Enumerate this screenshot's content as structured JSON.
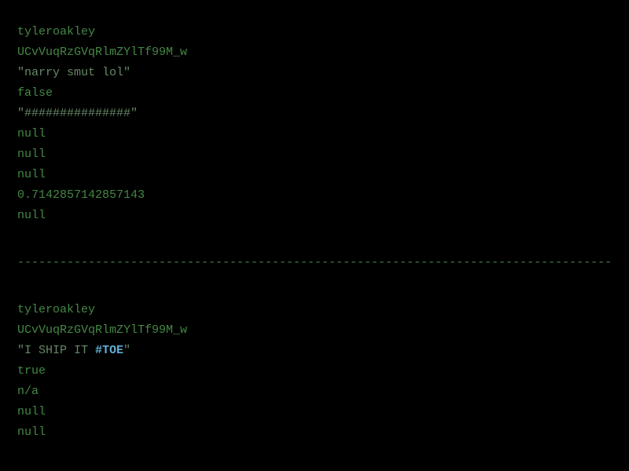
{
  "records": [
    {
      "username": "tyleroakley",
      "channel_id": "UCvVuqRzGVqRlmZYlTf99M_w",
      "title_prefix": "\"narry smut lol\"",
      "hashtag_in_title": null,
      "title_suffix": null,
      "flag": "false",
      "field5": "\"###############\"",
      "field6": "null",
      "field7": "null",
      "field8": "null",
      "field9": "0.7142857142857143",
      "field10": "null"
    },
    {
      "username": "tyleroakley",
      "channel_id": "UCvVuqRzGVqRlmZYlTf99M_w",
      "title_prefix": "\"I SHIP IT ",
      "hashtag_in_title": "#TOE",
      "title_suffix": "\"",
      "flag": "true",
      "field5": "n/a",
      "field6": "null",
      "field7": "null",
      "field8": null,
      "field9": null,
      "field10": null
    }
  ],
  "separator": "----------------------------------------------------------------------------------------------------------------------------------------------------------"
}
